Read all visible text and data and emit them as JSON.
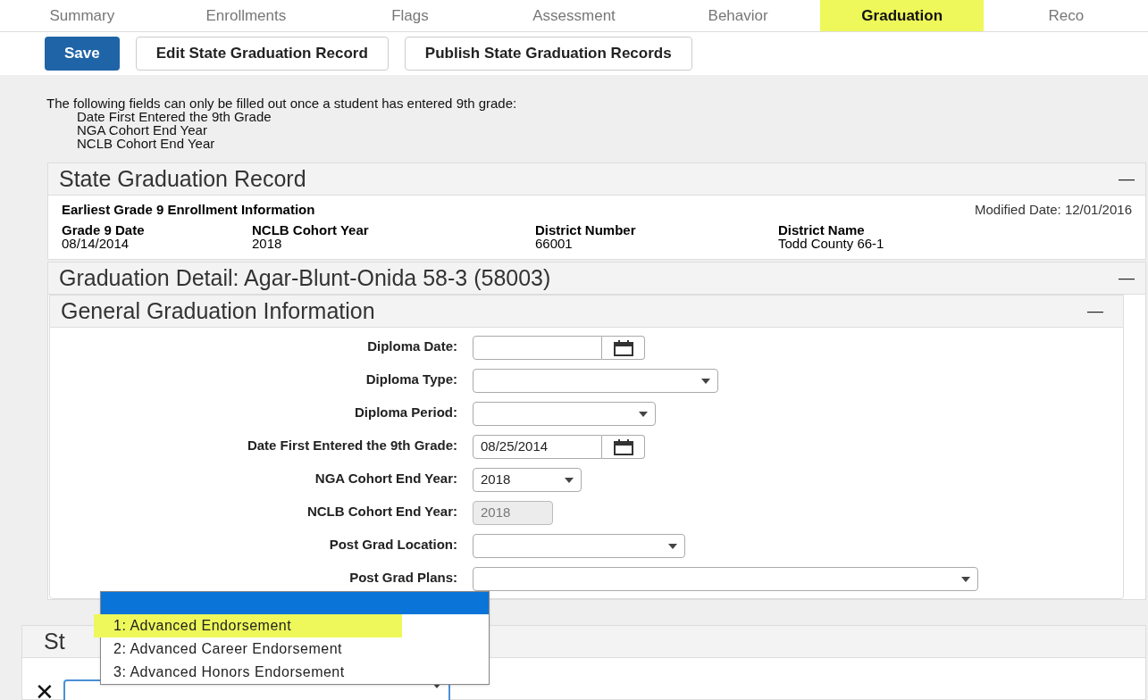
{
  "tabs": [
    {
      "label": "Summary",
      "selected": false
    },
    {
      "label": "Enrollments",
      "selected": false
    },
    {
      "label": "Flags",
      "selected": false
    },
    {
      "label": "Assessment",
      "selected": false
    },
    {
      "label": "Behavior",
      "selected": false
    },
    {
      "label": "Graduation",
      "selected": true
    },
    {
      "label": "Reco",
      "selected": false
    }
  ],
  "toolbar": {
    "buttons": [
      {
        "label": "Save",
        "kind": "primary"
      },
      {
        "label": "Edit State Graduation Record",
        "kind": "secondary"
      },
      {
        "label": "Publish State Graduation Records",
        "kind": "secondary"
      }
    ]
  },
  "notice": {
    "text": "The following fields can only be filled out once a student has entered 9th grade:",
    "items": [
      "Date First Entered the 9th Grade",
      "NGA Cohort End Year",
      "NCLB Cohort End Year"
    ]
  },
  "state_record": {
    "title": "State Graduation Record",
    "collapse": "—",
    "subtitle": "Earliest Grade 9 Enrollment Information",
    "modified": "Modified Date: 12/01/2016",
    "fields": [
      {
        "label": "Grade 9 Date",
        "value": "08/14/2014"
      },
      {
        "label": "NCLB Cohort Year",
        "value": "2018"
      },
      {
        "label": "District Number",
        "value": "66001"
      },
      {
        "label": "District Name",
        "value": "Todd County 66-1"
      }
    ]
  },
  "detail": {
    "title": "Graduation Detail: Agar-Blunt-Onida 58-3 (58003)",
    "collapse": "—"
  },
  "general": {
    "title": "General Graduation Information",
    "collapse": "—",
    "rows": [
      {
        "label": "Diploma Date:",
        "kind": "date"
      },
      {
        "label": "Diploma Type:",
        "kind": "select"
      },
      {
        "label": "Diploma Period:",
        "kind": "select"
      },
      {
        "label": "Date First Entered the 9th Grade:",
        "kind": "date",
        "value": "08/25/2014"
      },
      {
        "label": "NGA Cohort End Year:",
        "kind": "select",
        "value": "2018"
      },
      {
        "label": "NCLB Cohort End Year:",
        "kind": "readonly",
        "value": "2018"
      },
      {
        "label": "Post Grad Location:",
        "kind": "select"
      },
      {
        "label": "Post Grad Plans:",
        "kind": "select"
      }
    ]
  },
  "bottom_panel": {
    "title": "St",
    "remove": "✕"
  },
  "dropdown": {
    "blank_selected": true,
    "options": [
      {
        "label": "1: Advanced Endorsement",
        "highlighted": true
      },
      {
        "label": "2: Advanced Career Endorsement",
        "highlighted": false
      },
      {
        "label": "3: Advanced Honors Endorsement",
        "highlighted": false
      }
    ]
  }
}
